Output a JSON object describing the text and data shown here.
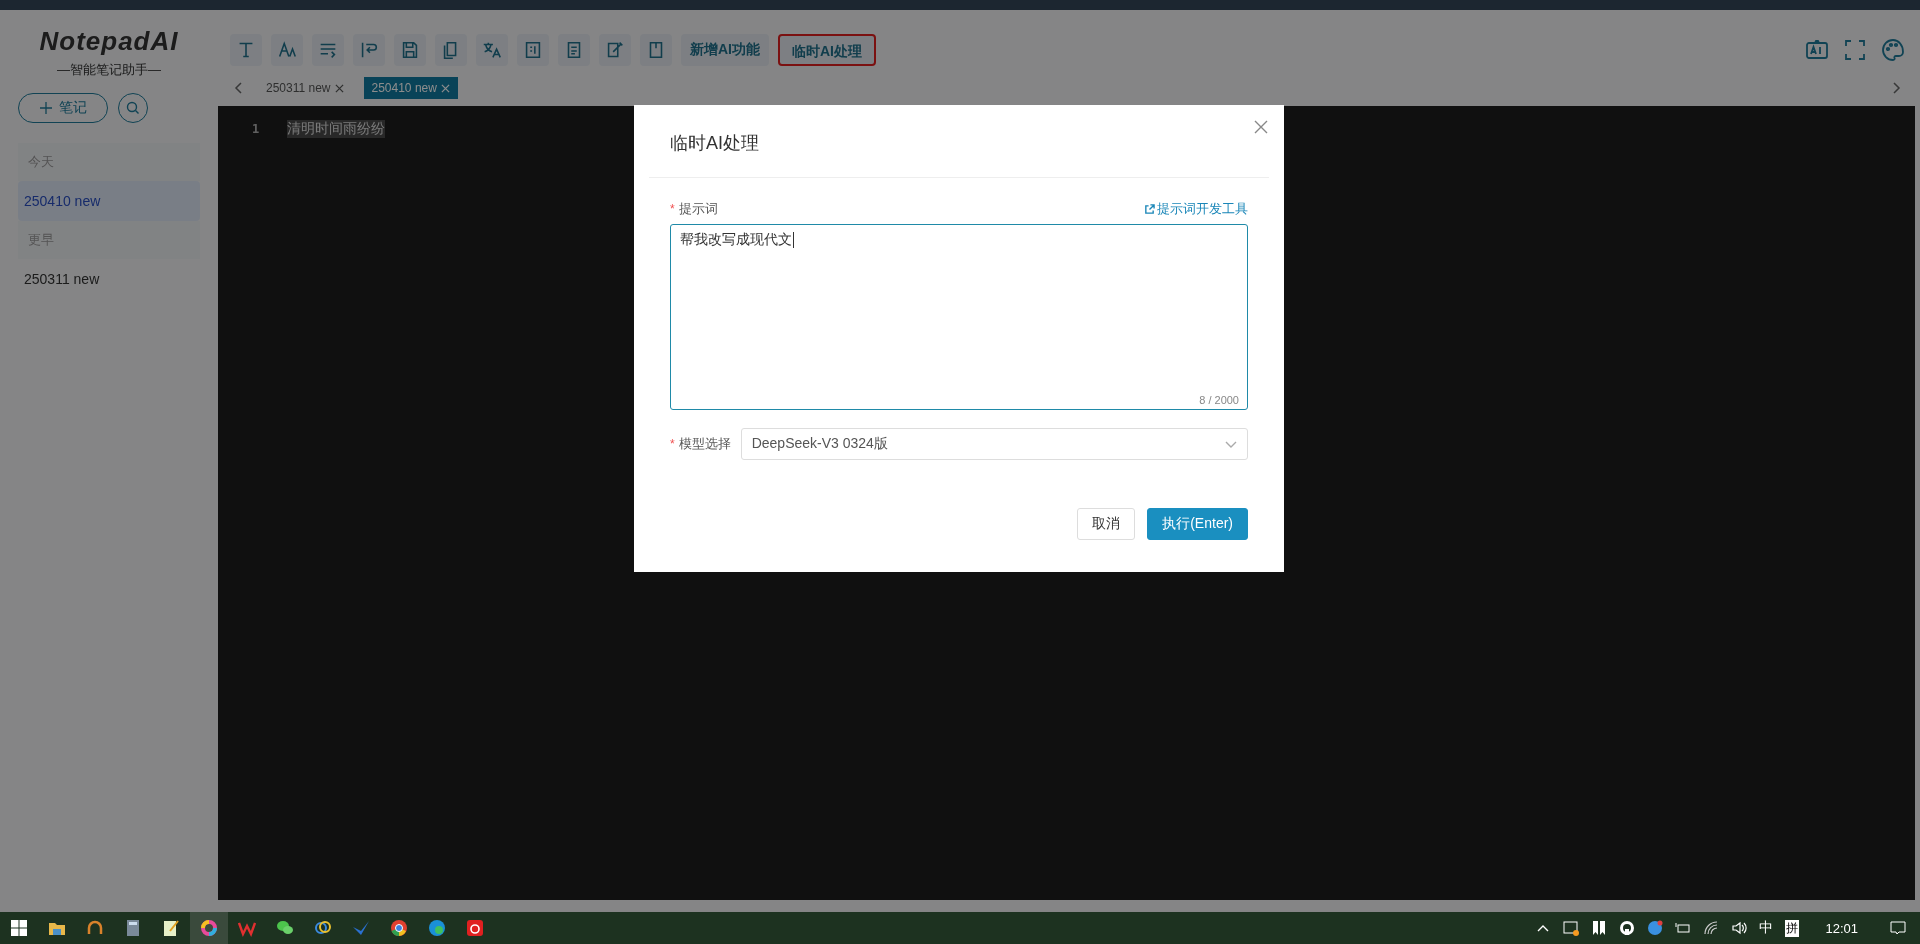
{
  "app": {
    "logo": "NotepadAI",
    "tagline": "—智能笔记助手—",
    "new_note_button": "笔记"
  },
  "sidebar": {
    "groups": [
      {
        "label": "今天",
        "items": [
          {
            "title": "250410 new",
            "selected": true
          }
        ]
      },
      {
        "label": "更早",
        "items": [
          {
            "title": "250311 new",
            "selected": false
          }
        ]
      }
    ]
  },
  "toolbar": {
    "text_buttons": [
      {
        "label": "新增AI功能",
        "highlighted": false
      },
      {
        "label": "临时AI处理",
        "highlighted": true
      }
    ]
  },
  "tabs": [
    {
      "label": "250311 new",
      "selected": false
    },
    {
      "label": "250410 new",
      "selected": true
    }
  ],
  "editor": {
    "lines": [
      {
        "number": "1",
        "text": "清明时间雨纷纷",
        "selected": true
      }
    ]
  },
  "dialog": {
    "title": "临时AI处理",
    "required_mark": "*",
    "prompt_label": "提示词",
    "tool_link": "提示词开发工具",
    "prompt_value": "帮我改写成现代文",
    "counter": "8 / 2000",
    "model_label": "模型选择",
    "model_value": "DeepSeek-V3 0324版",
    "buttons": [
      {
        "label": "取消",
        "kind": "default"
      },
      {
        "label": "执行(Enter)",
        "kind": "primary"
      }
    ]
  },
  "taskbar": {
    "ime": "中",
    "ime_mode": "拼",
    "time": "12:01"
  }
}
